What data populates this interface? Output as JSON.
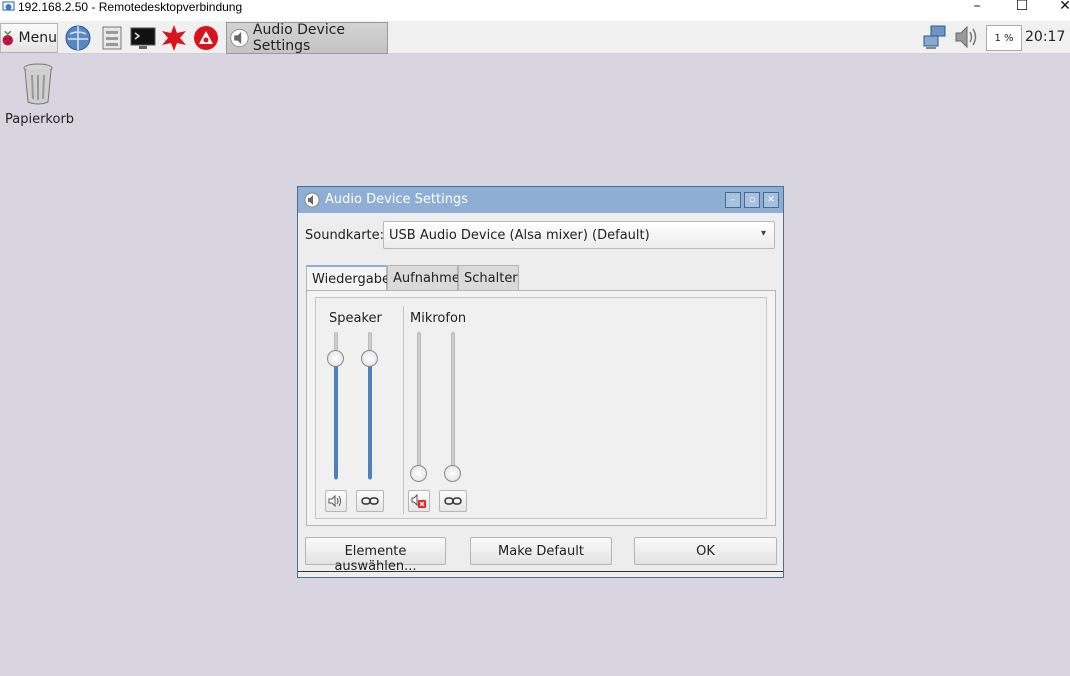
{
  "rdp": {
    "title": "192.168.2.50 - Remotedesktopverbindung",
    "minimize_icon": "minimize-icon",
    "maximize_icon": "maximize-icon",
    "close_icon": "close-icon"
  },
  "taskbar": {
    "menu_label": "Menu",
    "launchers": [
      "browser-globe-icon",
      "file-manager-icon",
      "terminal-icon",
      "math-kernel-icon",
      "wolfram-icon"
    ],
    "active_task_label": "Audio Device Settings",
    "tray": {
      "network_icon": "network-icon",
      "volume_icon": "volume-icon",
      "cpu_text": "1 %",
      "clock": "20:17"
    }
  },
  "desktop": {
    "trash_label": "Papierkorb"
  },
  "dialog": {
    "title": "Audio Device Settings",
    "soundcard_label": "Soundkarte:",
    "soundcard_value": "USB Audio Device (Alsa mixer) (Default)",
    "tabs": [
      {
        "label": "Wiedergabe",
        "active": true
      },
      {
        "label": "Aufnahme",
        "active": false
      },
      {
        "label": "Schalter",
        "active": false
      }
    ],
    "groups": [
      {
        "label": "Speaker",
        "levels": [
          0.83,
          0.83
        ],
        "muted": false,
        "linked": true
      },
      {
        "label": "Mikrofon",
        "levels": [
          0.0,
          0.0
        ],
        "muted": true,
        "linked": true
      }
    ],
    "buttons": {
      "select_elements": "Elemente auswählen...",
      "make_default": "Make Default",
      "ok": "OK"
    }
  },
  "colors": {
    "desktop_bg": "#d8d5e0",
    "titlebar": "#8eaed4",
    "slider_fill": "#4f7fbf"
  }
}
